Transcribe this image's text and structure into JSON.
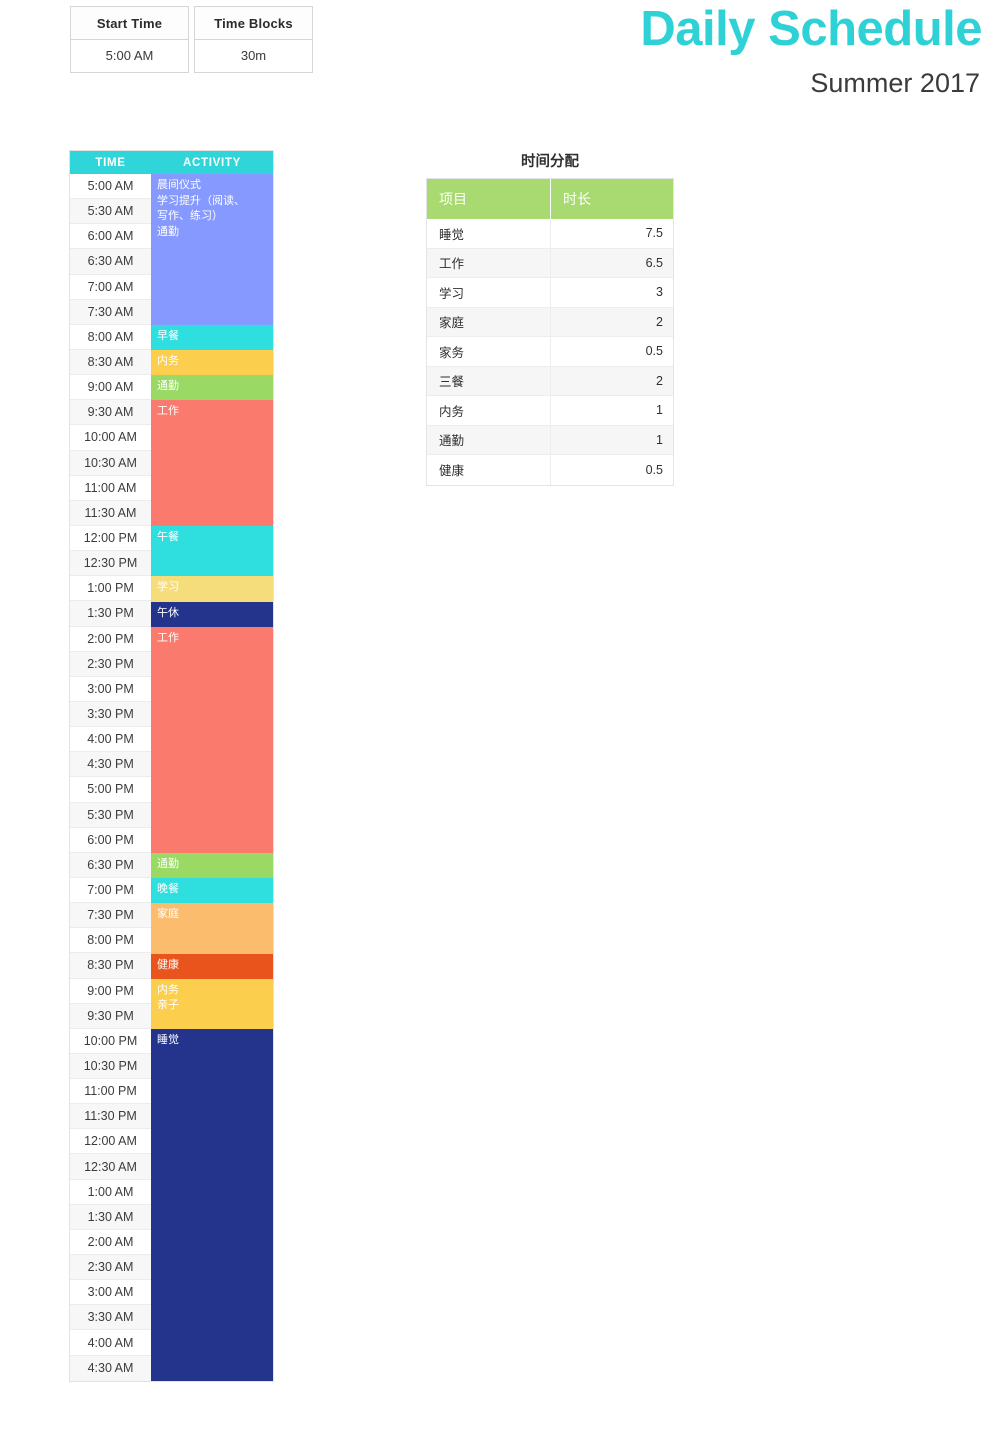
{
  "settings": [
    {
      "name": "start-time",
      "header": "Start Time",
      "value": "5:00 AM"
    },
    {
      "name": "time-blocks",
      "header": "Time Blocks",
      "value": "30m"
    }
  ],
  "title": {
    "main": "Daily Schedule",
    "subtitle": "Summer 2017",
    "accent_color": "#2ed2d6"
  },
  "schedule": {
    "columns": [
      "TIME",
      "ACTIVITY"
    ],
    "header_color": "#2fd5d8",
    "times": [
      "5:00 AM",
      "5:30 AM",
      "6:00 AM",
      "6:30 AM",
      "7:00 AM",
      "7:30 AM",
      "8:00 AM",
      "8:30 AM",
      "9:00 AM",
      "9:30 AM",
      "10:00 AM",
      "10:30 AM",
      "11:00 AM",
      "11:30 AM",
      "12:00 PM",
      "12:30 PM",
      "1:00 PM",
      "1:30 PM",
      "2:00 PM",
      "2:30 PM",
      "3:00 PM",
      "3:30 PM",
      "4:00 PM",
      "4:30 PM",
      "5:00 PM",
      "5:30 PM",
      "6:00 PM",
      "6:30 PM",
      "7:00 PM",
      "7:30 PM",
      "8:00 PM",
      "8:30 PM",
      "9:00 PM",
      "9:30 PM",
      "10:00 PM",
      "10:30 PM",
      "11:00 PM",
      "11:30 PM",
      "12:00 AM",
      "12:30 AM",
      "1:00 AM",
      "1:30 AM",
      "2:00 AM",
      "2:30 AM",
      "3:00 AM",
      "3:30 AM",
      "4:00 AM",
      "4:30 AM"
    ],
    "blocks": [
      {
        "label": "晨间仪式\n学习提升（阅读、\n写作、练习）\n通勤",
        "start": 0,
        "span": 6,
        "color": "#8599ff"
      },
      {
        "label": "早餐",
        "start": 6,
        "span": 1,
        "color": "#2fdfe0"
      },
      {
        "label": "内务",
        "start": 7,
        "span": 1,
        "color": "#fcce4e"
      },
      {
        "label": "通勤",
        "start": 8,
        "span": 1,
        "color": "#9ad964"
      },
      {
        "label": "工作",
        "start": 9,
        "span": 5,
        "color": "#fa7a6d"
      },
      {
        "label": "午餐",
        "start": 14,
        "span": 2,
        "color": "#2fdfe0"
      },
      {
        "label": "学习",
        "start": 16,
        "span": 1,
        "color": "#f6dd7c"
      },
      {
        "label": "午休",
        "start": 17,
        "span": 1,
        "color": "#24348c"
      },
      {
        "label": "工作",
        "start": 18,
        "span": 9,
        "color": "#fa7a6d"
      },
      {
        "label": "通勤",
        "start": 27,
        "span": 1,
        "color": "#9ad964"
      },
      {
        "label": "晚餐",
        "start": 28,
        "span": 1,
        "color": "#2fdfe0"
      },
      {
        "label": "家庭",
        "start": 29,
        "span": 2,
        "color": "#fbbc6e"
      },
      {
        "label": "健康",
        "start": 31,
        "span": 1,
        "color": "#e8541c"
      },
      {
        "label": "内务\n亲子",
        "start": 32,
        "span": 2,
        "color": "#fcce4e"
      },
      {
        "label": "睡觉",
        "start": 34,
        "span": 14,
        "color": "#24348c"
      }
    ]
  },
  "summary": {
    "title": "时间分配",
    "header_color": "#a8da71",
    "columns": [
      "项目",
      "时长"
    ],
    "rows": [
      {
        "label": "睡觉",
        "value": "7.5"
      },
      {
        "label": "工作",
        "value": "6.5"
      },
      {
        "label": "学习",
        "value": "3"
      },
      {
        "label": "家庭",
        "value": "2"
      },
      {
        "label": "家务",
        "value": "0.5"
      },
      {
        "label": "三餐",
        "value": "2"
      },
      {
        "label": "内务",
        "value": "1"
      },
      {
        "label": "通勤",
        "value": "1"
      },
      {
        "label": "健康",
        "value": "0.5"
      }
    ]
  }
}
